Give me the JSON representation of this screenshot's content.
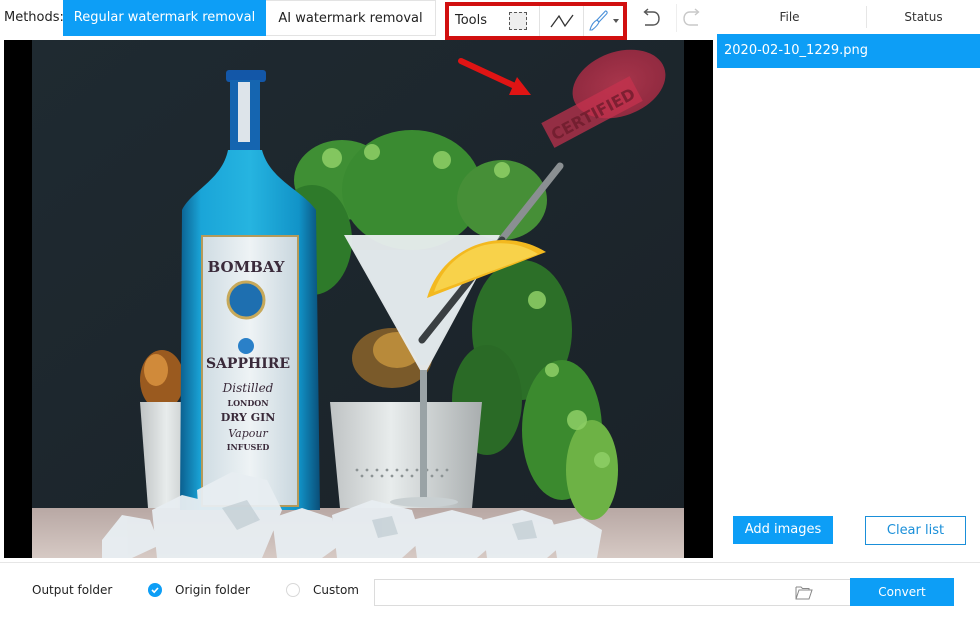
{
  "toolbar": {
    "methods_label": "Methods:",
    "methods": [
      {
        "label": "Regular watermark removal",
        "active": true
      },
      {
        "label": "AI watermark removal",
        "active": false
      }
    ],
    "tools_label": "Tools",
    "tools": [
      {
        "icon": "rectangle-select-icon"
      },
      {
        "icon": "polyline-icon"
      },
      {
        "icon": "brush-icon",
        "has_dropdown": true
      }
    ],
    "undo_icon": "undo-icon",
    "redo_icon": "redo-icon"
  },
  "canvas": {
    "image_description": "Bombay Sapphire gin bottle with martini glass, orange slice, herbs and ice",
    "bottle_label": {
      "brand_top": "BOMBAY",
      "brand_bottom": "SAPPHIRE",
      "line1": "Distilled",
      "line2": "LONDON",
      "line3": "DRY GIN",
      "line4": "Vapour",
      "line5": "INFUSED"
    },
    "watermark_text": "CERTIFIED"
  },
  "file_panel": {
    "columns": [
      "File",
      "Status"
    ],
    "files": [
      {
        "name": "2020-02-10_1229.png",
        "status": "",
        "selected": true
      }
    ],
    "add_images_label": "Add images",
    "clear_list_label": "Clear list"
  },
  "output": {
    "label": "Output folder",
    "options": [
      {
        "label": "Origin folder",
        "selected": true
      },
      {
        "label": "Custom",
        "selected": false
      }
    ],
    "path_value": "",
    "folder_icon": "folder-icon",
    "convert_label": "Convert"
  },
  "colors": {
    "accent": "#0d9ef6",
    "annotation_red": "#d10f0f",
    "photo_background": "#1f2a31"
  }
}
